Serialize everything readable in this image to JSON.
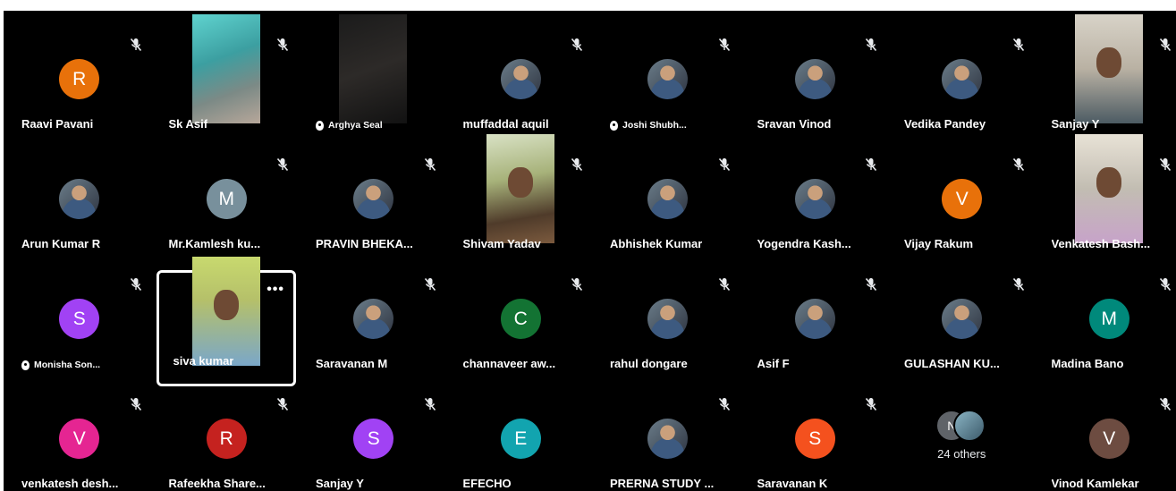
{
  "meeting": {
    "others_count_label": "24 others",
    "others_avatar_initial": "N"
  },
  "tiles": [
    {
      "name": "Raavi Pavani",
      "kind": "initial",
      "initial": "R",
      "color": "#e8710a",
      "muted": true
    },
    {
      "name": "Sk Asif",
      "kind": "video",
      "video": "v-teal",
      "muted": true
    },
    {
      "name": "Arghya Seal",
      "kind": "video",
      "video": "v-dark",
      "muted": false,
      "pinned": true
    },
    {
      "name": "muffaddal aquil",
      "kind": "photo",
      "color": "#f6c026",
      "muted": true
    },
    {
      "name": "Joshi Shubh...",
      "kind": "photo",
      "color": "#8d8d8d",
      "muted": true,
      "pinned": true
    },
    {
      "name": "Sravan Vinod",
      "kind": "photo",
      "color": "#5a4a3a",
      "muted": true
    },
    {
      "name": "Vedika Pandey",
      "kind": "photo",
      "color": "#b5512a",
      "muted": true
    },
    {
      "name": "Sanjay Y",
      "kind": "video",
      "video": "v-room",
      "muted": true
    },
    {
      "name": "Arun Kumar R",
      "kind": "photo",
      "color": "#a34a3a",
      "muted": false
    },
    {
      "name": "Mr.Kamlesh ku...",
      "kind": "initial",
      "initial": "M",
      "color": "#78909c",
      "muted": true
    },
    {
      "name": "PRAVIN BHEKA...",
      "kind": "photo",
      "color": "#8bc34a",
      "muted": true
    },
    {
      "name": "Shivam Yadav",
      "kind": "video",
      "video": "v-tree",
      "muted": true
    },
    {
      "name": "Abhishek Kumar",
      "kind": "photo",
      "color": "#2e5c8a",
      "muted": true
    },
    {
      "name": "Yogendra Kash...",
      "kind": "photo",
      "color": "#f4d03f",
      "muted": true
    },
    {
      "name": "Vijay Rakum",
      "kind": "initial",
      "initial": "V",
      "color": "#e8710a",
      "muted": true
    },
    {
      "name": "Venkatesh Bash...",
      "kind": "video",
      "video": "v-pink",
      "muted": true
    },
    {
      "name": "Monisha Son...",
      "kind": "initial",
      "initial": "S",
      "color": "#a142f4",
      "muted": true,
      "pinned": true
    },
    {
      "name": "siva kumar",
      "kind": "video",
      "video": "v-office",
      "muted": false,
      "active": true,
      "more": "•••"
    },
    {
      "name": "Saravanan M",
      "kind": "photo",
      "color": "#4a90c2",
      "muted": true
    },
    {
      "name": "channaveer aw...",
      "kind": "initial",
      "initial": "C",
      "color": "#137333",
      "muted": true
    },
    {
      "name": "rahul dongare",
      "kind": "photo",
      "color": "#5c6b73",
      "muted": true
    },
    {
      "name": "Asif F",
      "kind": "photo",
      "color": "#3e6b4a",
      "muted": true
    },
    {
      "name": "GULASHAN KU...",
      "kind": "photo",
      "color": "#6f8fa8",
      "muted": true
    },
    {
      "name": "Madina Bano",
      "kind": "initial",
      "initial": "M",
      "color": "#00897b",
      "muted": true
    },
    {
      "name": "venkatesh desh...",
      "kind": "initial",
      "initial": "V",
      "color": "#e52592",
      "muted": true
    },
    {
      "name": "Rafeekha Share...",
      "kind": "initial",
      "initial": "R",
      "color": "#c5221f",
      "muted": true
    },
    {
      "name": "Sanjay Y",
      "kind": "initial",
      "initial": "S",
      "color": "#a142f4",
      "muted": true
    },
    {
      "name": "EFECHO",
      "kind": "initial",
      "initial": "E",
      "color": "#12a4af",
      "muted": false
    },
    {
      "name": "PRERNA STUDY ...",
      "kind": "photo",
      "color": "#1a3f8a",
      "muted": true
    },
    {
      "name": "Saravanan K",
      "kind": "initial",
      "initial": "S",
      "color": "#f4511e",
      "muted": true
    },
    {
      "name": "",
      "kind": "others",
      "muted": false
    },
    {
      "name": "Vinod Kamlekar",
      "kind": "initial",
      "initial": "V",
      "color": "#6d4c41",
      "muted": true
    }
  ],
  "icons": {
    "muted": "mic-off-icon",
    "pinned": "pin-icon",
    "more": "more-options-icon"
  }
}
